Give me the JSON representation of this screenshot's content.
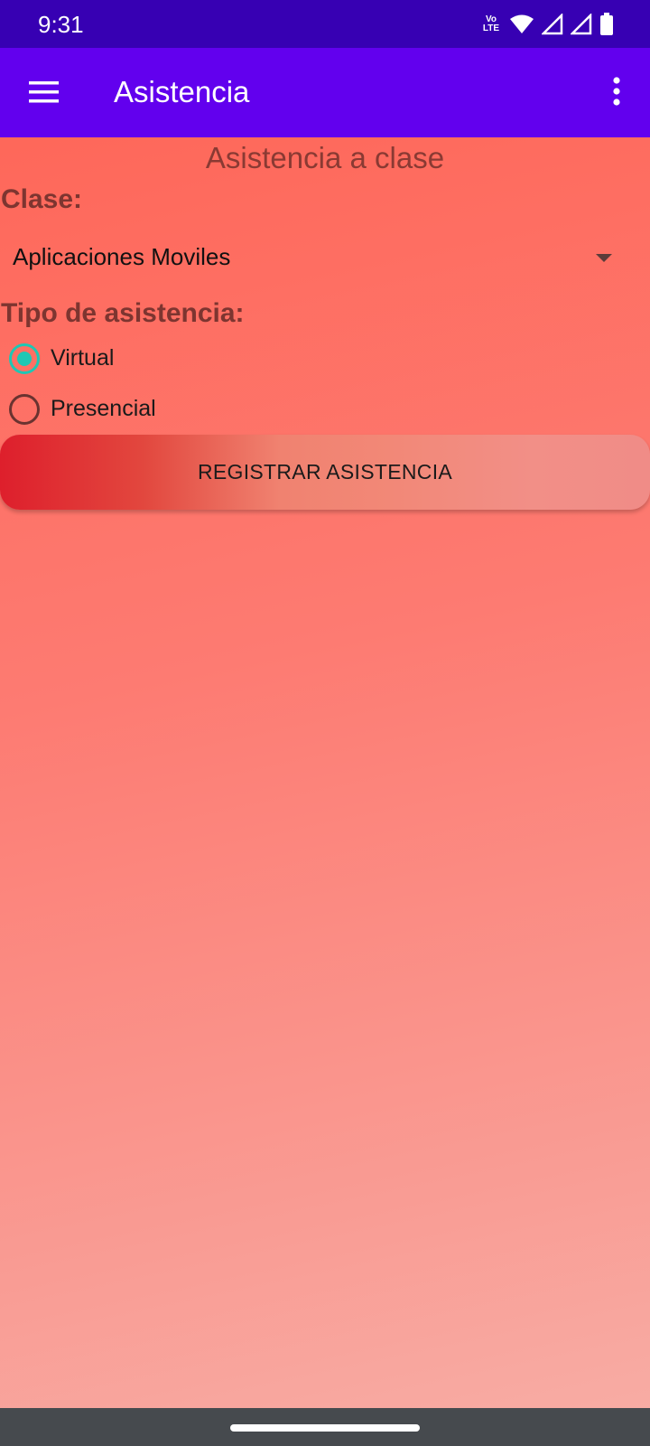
{
  "status_bar": {
    "time": "9:31",
    "volte_line1": "Vo",
    "volte_line2": "LTE",
    "icons": [
      "volte-icon",
      "wifi-icon",
      "signal-icon",
      "signal-icon",
      "battery-icon"
    ]
  },
  "app_bar": {
    "title": "Asistencia",
    "menu_icon": "hamburger-menu-icon",
    "overflow_icon": "more-vert-icon",
    "color": "#6200ee"
  },
  "form": {
    "heading": "Asistencia a clase",
    "clase_label": "Clase:",
    "clase_selected": "Aplicaciones Moviles",
    "tipo_label": "Tipo de asistencia:",
    "options": [
      {
        "label": "Virtual",
        "checked": true
      },
      {
        "label": "Presencial",
        "checked": false
      }
    ],
    "accent_color": "#1ec7b4",
    "submit_label": "REGISTRAR ASISTENCIA"
  }
}
